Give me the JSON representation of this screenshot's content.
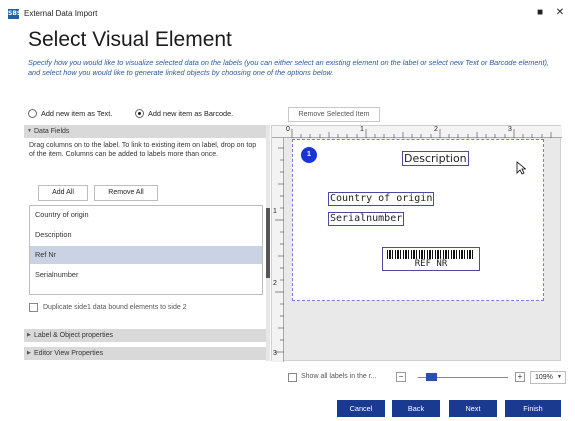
{
  "window": {
    "app_icon_text": "SBS",
    "title": "External Data Import",
    "maximize_glyph": "■",
    "close_glyph": "✕"
  },
  "page": {
    "heading": "Select Visual Element",
    "instructions": "Specify how you would like to visualize selected data on the labels (you can either select an existing element on the label or select new Text or Barcode element), and select how you would like to generate linked objects by choosing one of the options below."
  },
  "options": {
    "add_as_text": "Add new item as Text.",
    "add_as_barcode": "Add new item as Barcode.",
    "selected": "barcode",
    "remove_selected_label": "Remove Selected Item"
  },
  "data_fields": {
    "section_title": "Data Fields",
    "help_text": "Drag columns on to the label. To link to existing item on label, drop on top of the item. Columns can be added to labels more than once.",
    "add_all_label": "Add All",
    "remove_all_label": "Remove All",
    "items": [
      {
        "label": "Country of origin",
        "selected": false
      },
      {
        "label": "Description",
        "selected": false
      },
      {
        "label": "Ref Nr",
        "selected": true
      },
      {
        "label": "Serialnumber",
        "selected": false
      }
    ],
    "duplicate_label": "Duplicate side1 data bound elements to side 2"
  },
  "sections": {
    "label_object_props": "Label & Object properties",
    "editor_view_props": "Editor View Properties"
  },
  "canvas": {
    "badge": "1",
    "ruler_top": [
      "0",
      "1",
      "2",
      "3"
    ],
    "ruler_left": [
      "1",
      "2",
      "3"
    ],
    "elements": {
      "description": "Description",
      "country": "Country of origin",
      "serial": "Serialnumber",
      "barcode_text": "REF NR"
    }
  },
  "bottom": {
    "show_all_label": "Show all labels in the r...",
    "zoom": "109%",
    "zoom_out": "−",
    "zoom_in": "+"
  },
  "actions": {
    "cancel": "Cancel",
    "back": "Back",
    "next": "Next",
    "finish": "Finish"
  },
  "colors": {
    "accent": "#1a3a8f",
    "instruction_text": "#2b5aa0",
    "selection": "#c9d3e3"
  }
}
